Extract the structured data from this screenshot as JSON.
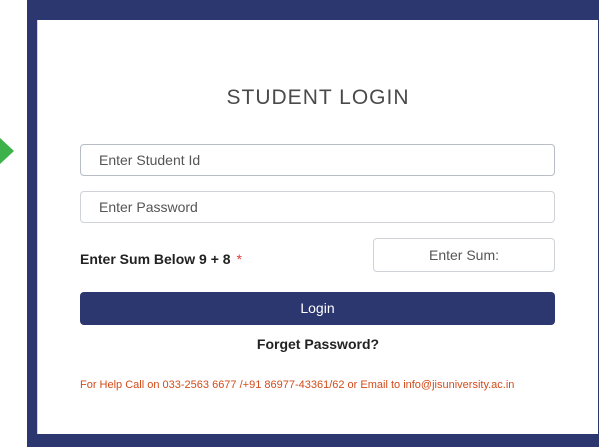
{
  "login": {
    "title": "STUDENT LOGIN",
    "student_id_placeholder": "Enter Student Id",
    "password_placeholder": "Enter Password",
    "sum_label": "Enter Sum Below 9 + 8",
    "required_mark": "*",
    "sum_placeholder": "Enter Sum:",
    "login_button": "Login",
    "forget_password": "Forget Password?",
    "help_text": "For Help Call on 033-2563 6677 /+91 86977-43361/62 or Email to info@jisuniversity.ac.in"
  },
  "colors": {
    "frame": "#2c3770",
    "button": "#2c3770",
    "arrow": "#3db24a",
    "help_text": "#d34b1a",
    "required": "#e23b3b"
  },
  "icons": {
    "arrow": "green-arrow-icon"
  }
}
